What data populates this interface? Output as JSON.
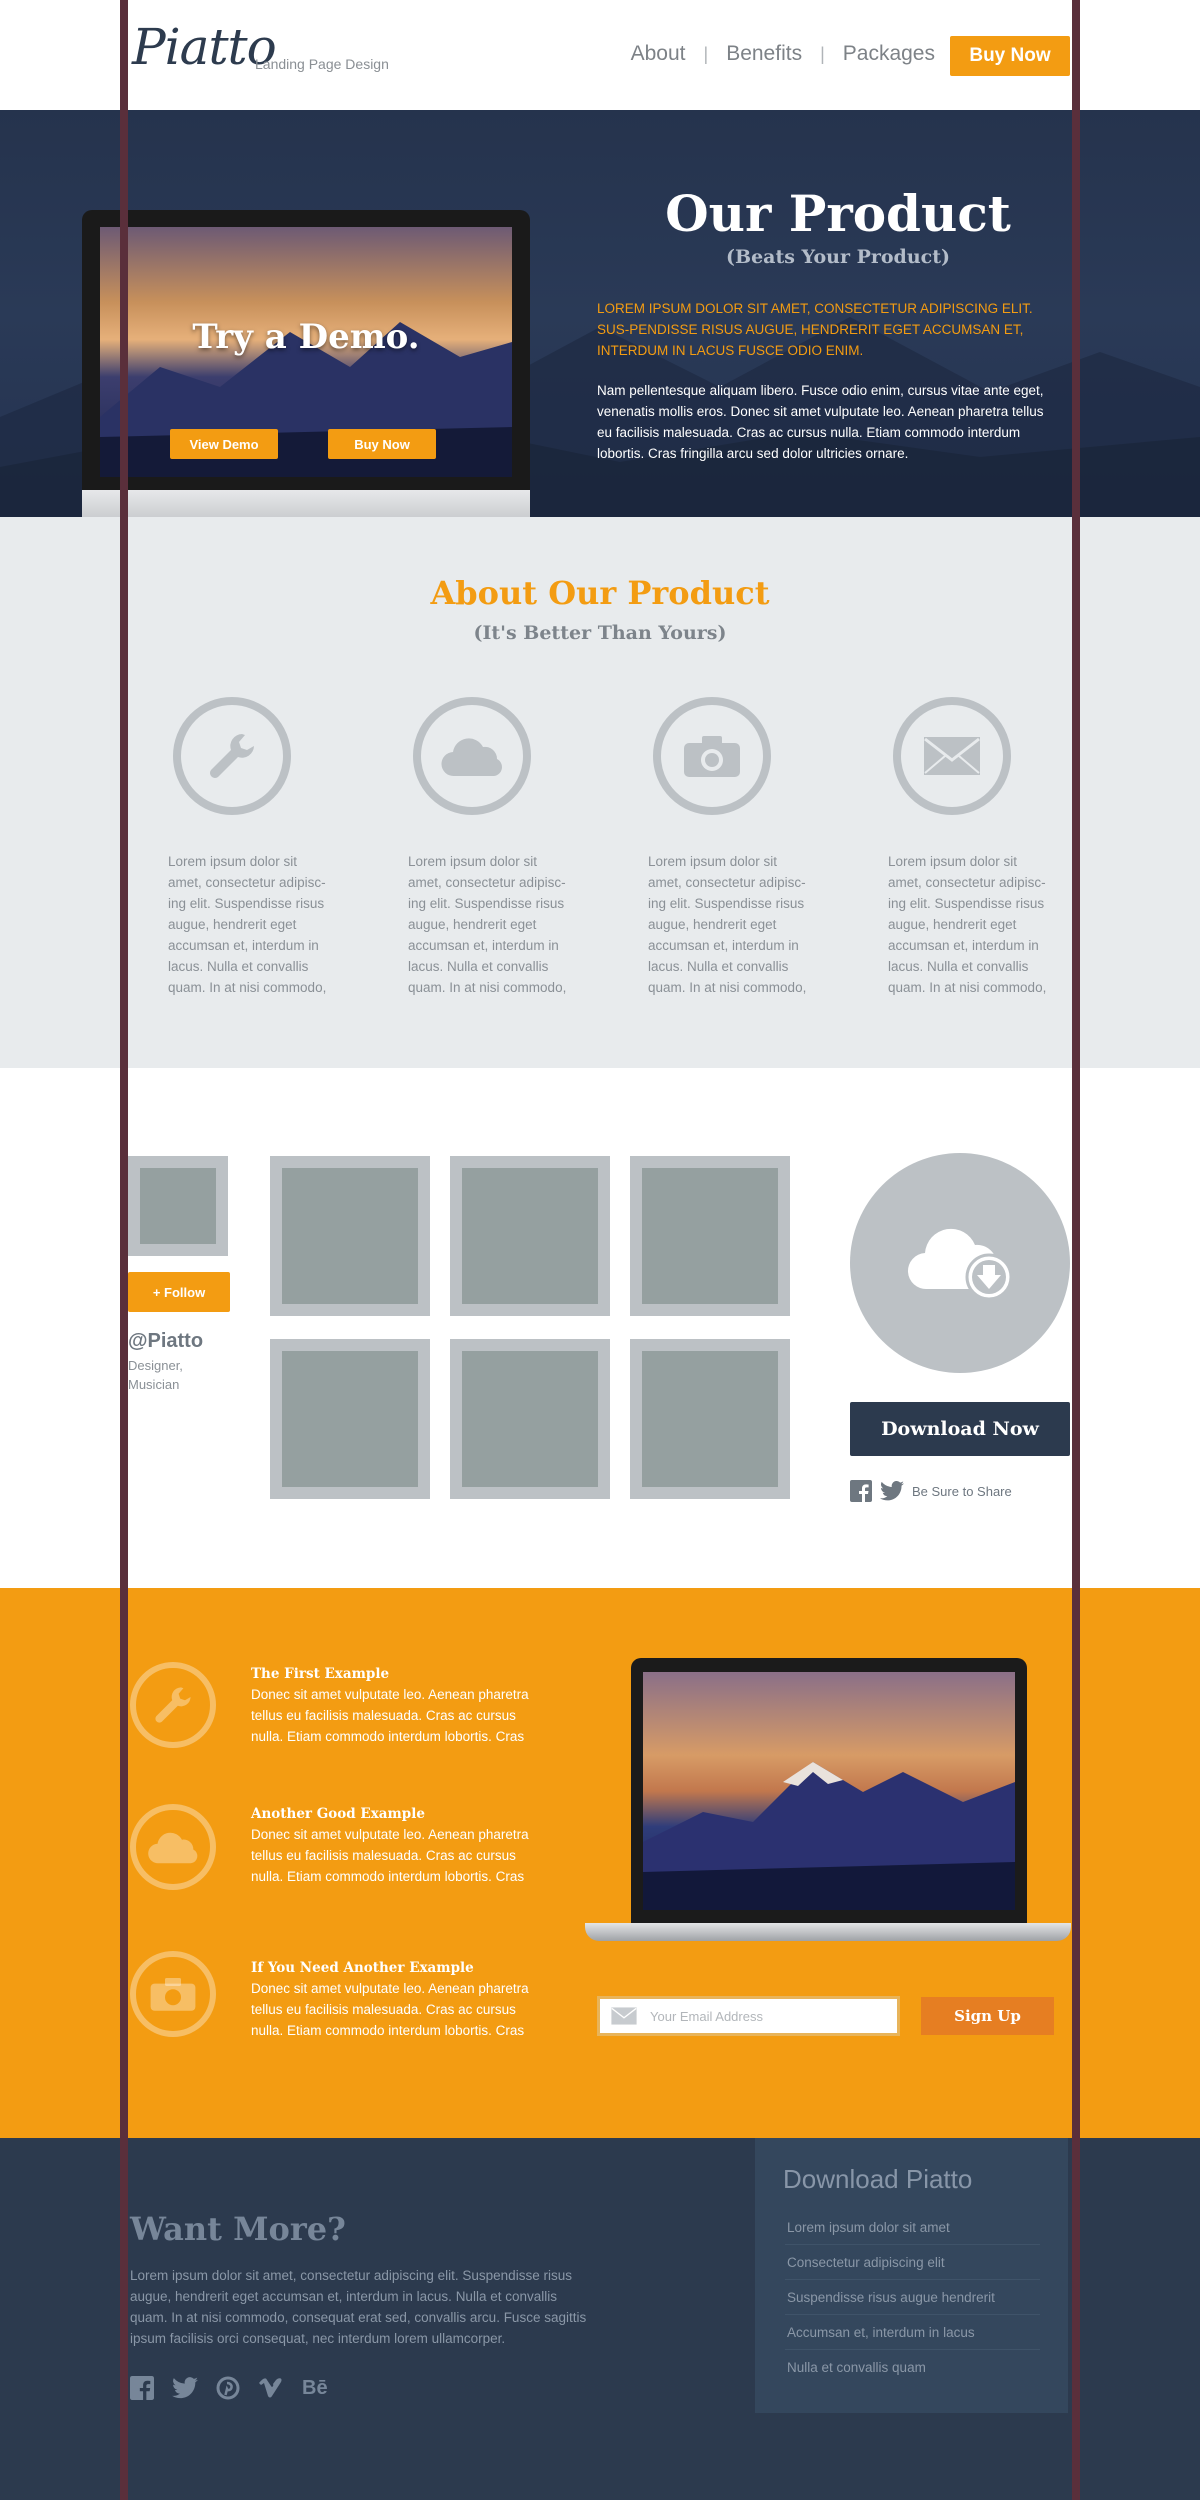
{
  "header": {
    "logo": "Piatto",
    "tagline": "Landing Page Design",
    "nav": [
      "About",
      "Benefits",
      "Packages"
    ],
    "buy_now": "Buy Now"
  },
  "hero": {
    "demo_title": "Try a Demo.",
    "view_demo": "View Demo",
    "buy_now": "Buy Now",
    "title": "Our Product",
    "subtitle": "(Beats Your Product)",
    "lead": "LOREM IPSUM DOLOR SIT AMET, CONSECTETUR ADIPISCING ELIT. SUS-PENDISSE RISUS AUGUE, HENDRERIT EGET ACCUMSAN ET, INTERDUM IN LACUS FUSCE ODIO ENIM.",
    "body": "Nam pellentesque aliquam libero. Fusce odio enim, cursus vitae ante eget, venenatis mollis eros. Donec sit amet vulputate leo. Aenean pharetra tellus eu facilisis malesuada. Cras ac cursus nulla. Etiam commodo interdum lobortis. Cras fringilla arcu sed dolor ultricies ornare."
  },
  "about": {
    "title": "About Our Product",
    "subtitle": "(It's Better Than Yours)",
    "features": [
      {
        "icon": "wrench-icon",
        "text": "Lorem ipsum dolor sit amet, consectetur adipisc-ing elit. Suspendisse risus augue, hendrerit eget accumsan et, interdum in lacus. Nulla et convallis quam. In at nisi commodo,"
      },
      {
        "icon": "cloud-icon",
        "text": "Lorem ipsum dolor sit amet, consectetur adipisc-ing elit. Suspendisse risus augue, hendrerit eget accumsan et, interdum in lacus. Nulla et convallis quam. In at nisi commodo,"
      },
      {
        "icon": "camera-icon",
        "text": "Lorem ipsum dolor sit amet, consectetur adipisc-ing elit. Suspendisse risus augue, hendrerit eget accumsan et, interdum in lacus. Nulla et convallis quam. In at nisi commodo,"
      },
      {
        "icon": "envelope-icon",
        "text": "Lorem ipsum dolor sit amet, consectetur adipisc-ing elit. Suspendisse risus augue, hendrerit eget accumsan et, interdum in lacus. Nulla et convallis quam. In at nisi commodo,"
      }
    ]
  },
  "social": {
    "follow": "+ Follow",
    "handle": "@Piatto",
    "role_line1": "Designer,",
    "role_line2": "Musician",
    "download_now": "Download Now",
    "share": "Be Sure to Share"
  },
  "examples": [
    {
      "icon": "wrench-icon",
      "title": "The First Example",
      "text": "Donec sit amet vulputate leo. Aenean pharetra tellus eu facilisis malesuada. Cras ac cursus nulla. Etiam commodo interdum lobortis. Cras"
    },
    {
      "icon": "cloud-icon",
      "title": "Another Good Example",
      "text": "Donec sit amet vulputate leo. Aenean pharetra tellus eu facilisis malesuada. Cras ac cursus nulla. Etiam commodo interdum lobortis. Cras"
    },
    {
      "icon": "camera-icon",
      "title": "If You Need Another Example",
      "text": "Donec sit amet vulputate leo. Aenean pharetra tellus eu facilisis malesuada. Cras ac cursus nulla. Etiam commodo interdum lobortis. Cras"
    }
  ],
  "signup": {
    "email_placeholder": "Your Email Address",
    "button": "Sign Up"
  },
  "footer": {
    "title": "Want More?",
    "text": "Lorem ipsum dolor sit amet, consectetur adipiscing elit. Suspendisse risus augue, hendrerit eget accumsan et, interdum in lacus. Nulla et convallis quam. In at nisi commodo, consequat erat sed, convallis arcu. Fusce sagittis ipsum facilisis orci consequat, nec interdum lorem ullamcorper.",
    "social": [
      "facebook-icon",
      "twitter-icon",
      "pinterest-icon",
      "vimeo-icon",
      "behance-icon"
    ],
    "behance_label": "Bē",
    "download_title": "Download Piatto",
    "download_links": [
      "Lorem ipsum dolor sit amet",
      "Consectetur adipiscing elit",
      "Suspendisse risus augue hendrerit",
      "Accumsan et, interdum in lacus",
      "Nulla et convallis quam"
    ]
  },
  "colors": {
    "accent": "#f39c12",
    "navy": "#2c3a4e",
    "about_bg": "#e8ebed",
    "guide": "#5a2f3b"
  }
}
